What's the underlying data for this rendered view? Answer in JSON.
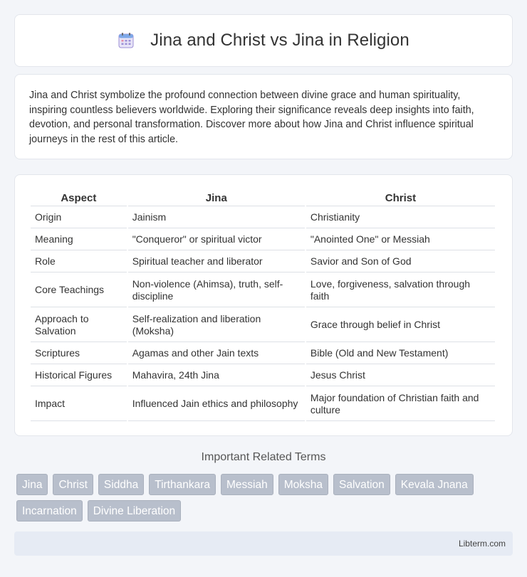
{
  "header": {
    "title": "Jina and Christ vs Jina in Religion",
    "icon": "calendar-icon"
  },
  "intro": {
    "text": "Jina and Christ symbolize the profound connection between divine grace and human spirituality, inspiring countless believers worldwide. Exploring their significance reveals deep insights into faith, devotion, and personal transformation. Discover more about how Jina and Christ influence spiritual journeys in the rest of this article."
  },
  "table": {
    "headers": [
      "Aspect",
      "Jina",
      "Christ"
    ],
    "rows": [
      [
        "Origin",
        "Jainism",
        "Christianity"
      ],
      [
        "Meaning",
        "\"Conqueror\" or spiritual victor",
        "\"Anointed One\" or Messiah"
      ],
      [
        "Role",
        "Spiritual teacher and liberator",
        "Savior and Son of God"
      ],
      [
        "Core Teachings",
        "Non-violence (Ahimsa), truth, self-discipline",
        "Love, forgiveness, salvation through faith"
      ],
      [
        "Approach to Salvation",
        "Self-realization and liberation (Moksha)",
        "Grace through belief in Christ"
      ],
      [
        "Scriptures",
        "Agamas and other Jain texts",
        "Bible (Old and New Testament)"
      ],
      [
        "Historical Figures",
        "Mahavira, 24th Jina",
        "Jesus Christ"
      ],
      [
        "Impact",
        "Influenced Jain ethics and philosophy",
        "Major foundation of Christian faith and culture"
      ]
    ]
  },
  "related": {
    "title": "Important Related Terms",
    "tags": [
      "Jina",
      "Christ",
      "Siddha",
      "Tirthankara",
      "Messiah",
      "Moksha",
      "Salvation",
      "Kevala Jnana",
      "Incarnation",
      "Divine Liberation"
    ]
  },
  "footer": {
    "site": "Libterm.com"
  },
  "colors": {
    "background": "#f3f5f9",
    "tag_bg": "#b8bfcc",
    "footer_bg": "#e6ebf4"
  }
}
